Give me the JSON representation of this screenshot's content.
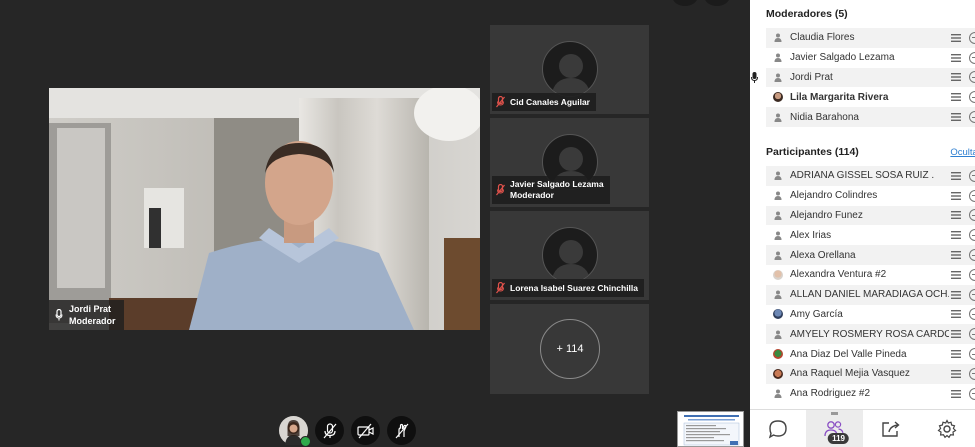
{
  "main_speaker": {
    "name": "Jordi Prat",
    "role": "Moderador"
  },
  "tiles": [
    {
      "name": "Cid Canales Aguilar",
      "role": ""
    },
    {
      "name": "Javier Salgado Lezama",
      "role": "Moderador"
    },
    {
      "name": "Lorena Isabel Suarez Chinchilla",
      "role": ""
    }
  ],
  "more_count": "+ 114",
  "moderators": {
    "title": "Moderadores (5)",
    "items": [
      {
        "name": "Claudia Flores"
      },
      {
        "name": "Javier Salgado Lezama"
      },
      {
        "name": "Jordi Prat"
      },
      {
        "name": "Lila Margarita Rivera"
      },
      {
        "name": "Nidia Barahona"
      }
    ]
  },
  "participants": {
    "title": "Participantes (114)",
    "hide_label": "Ocultar",
    "items": [
      {
        "name": "ADRIANA GISSEL SOSA RUIZ ."
      },
      {
        "name": "Alejandro Colindres"
      },
      {
        "name": "Alejandro Funez"
      },
      {
        "name": "Alex Irias"
      },
      {
        "name": "Alexa Orellana"
      },
      {
        "name": "Alexandra Ventura #2"
      },
      {
        "name": "ALLAN DANIEL MARADIAGA OCH..."
      },
      {
        "name": "Amy García"
      },
      {
        "name": "AMYELY ROSMERY ROSA CARDO..."
      },
      {
        "name": "Ana Diaz Del Valle Pineda"
      },
      {
        "name": "Ana Raquel Mejia Vasquez"
      },
      {
        "name": "Ana Rodriguez #2"
      }
    ]
  },
  "bottom_tabs": {
    "participants_badge": "119"
  },
  "colors": {
    "accent": "#2d7fd1",
    "mic_off": "#e0524b",
    "ok": "#2faa4b"
  }
}
